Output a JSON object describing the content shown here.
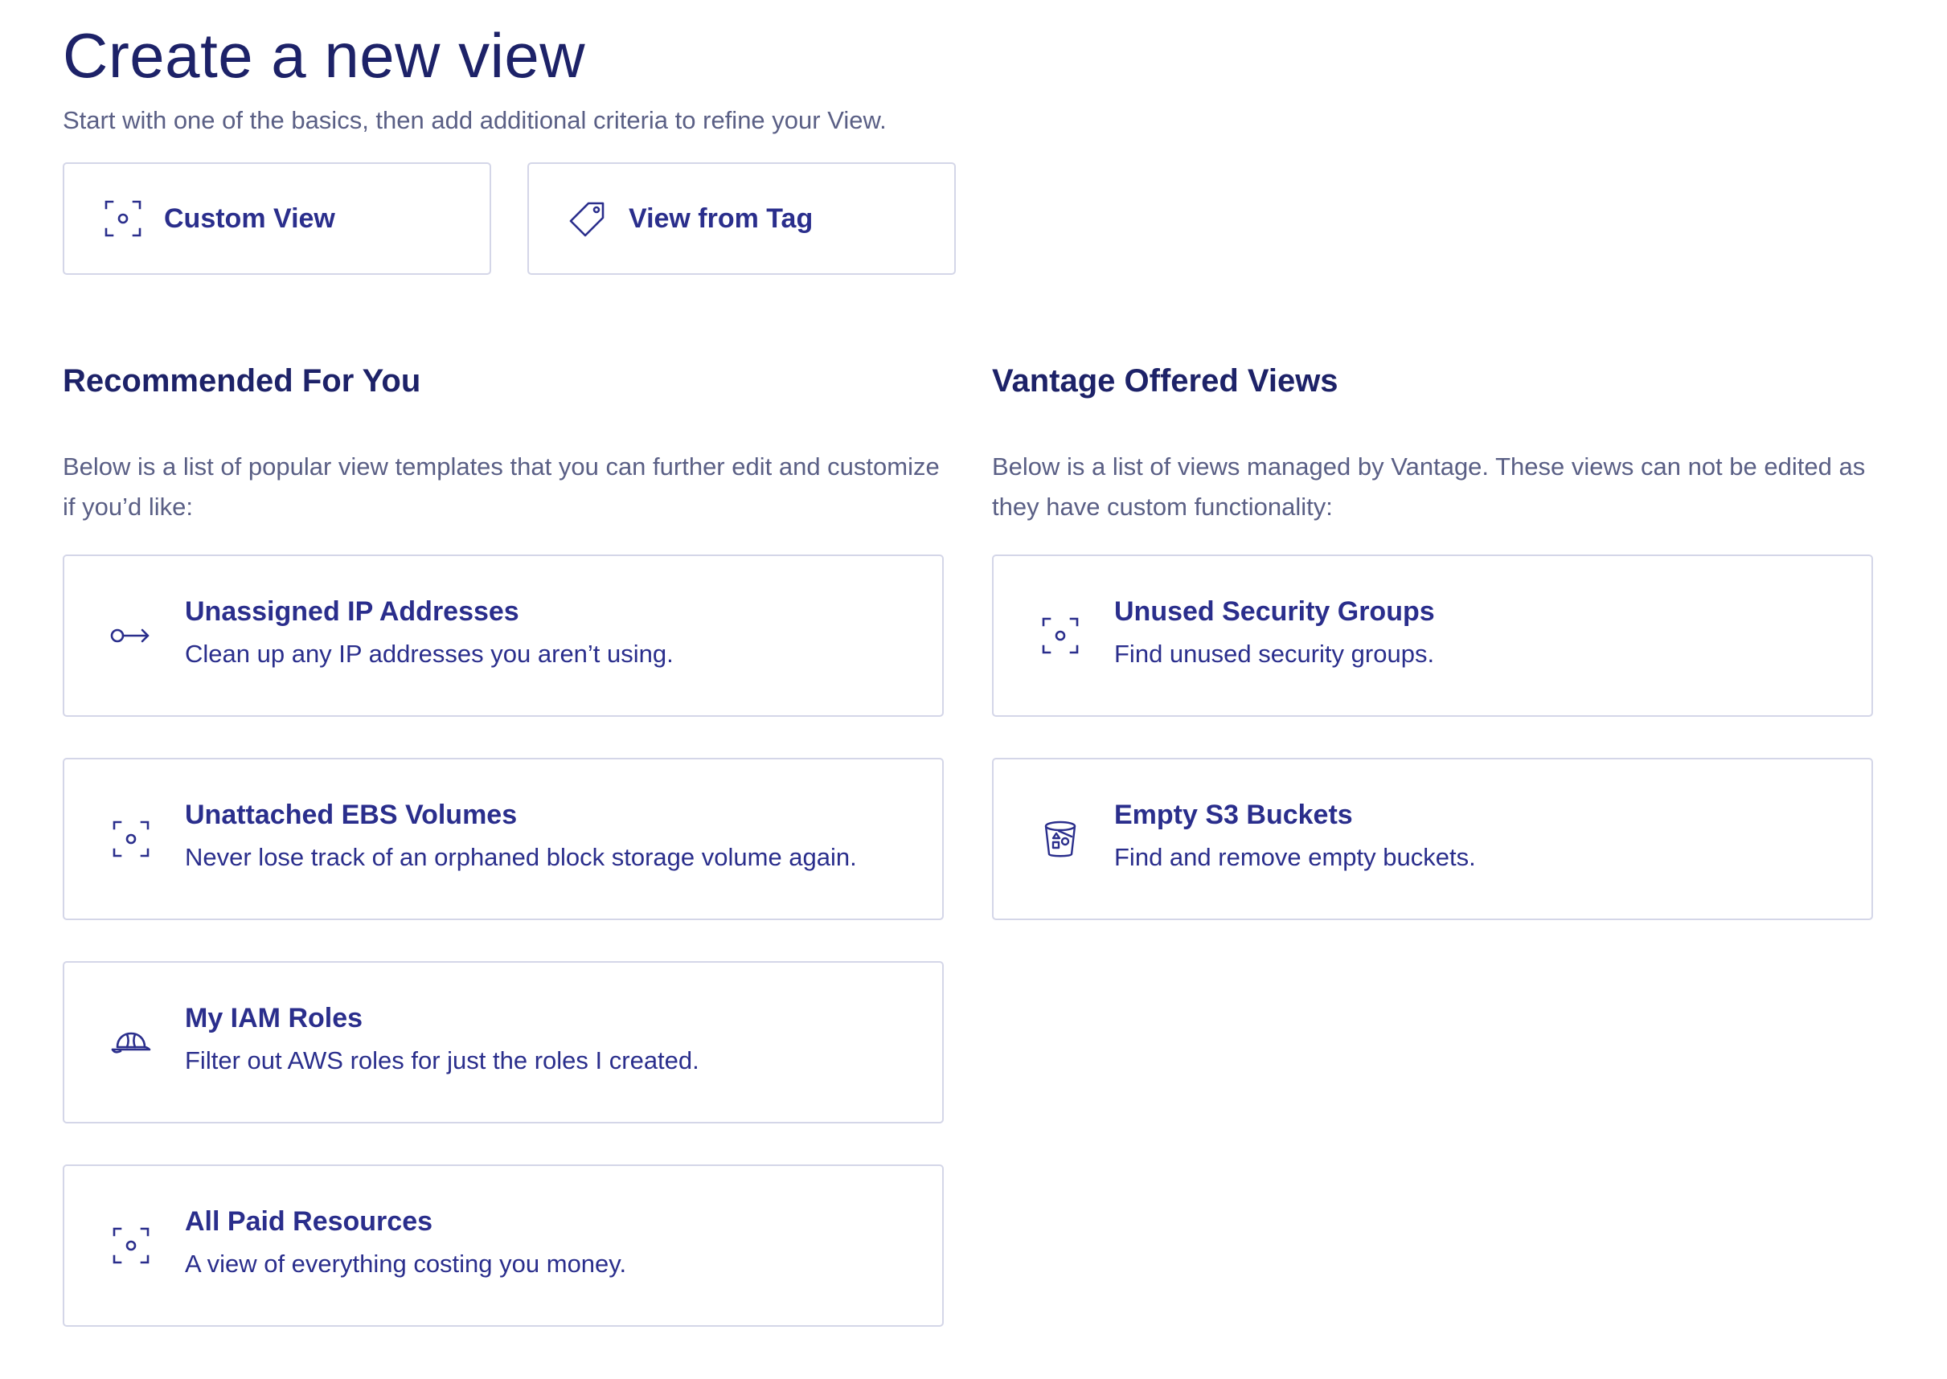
{
  "header": {
    "title": "Create a new view",
    "subtitle": "Start with one of the basics, then add additional criteria to refine your View."
  },
  "basics": [
    {
      "label": "Custom View",
      "icon": "focus-icon"
    },
    {
      "label": "View from Tag",
      "icon": "tag-icon"
    }
  ],
  "recommended": {
    "title": "Recommended For You",
    "description": "Below is a list of popular view templates that you can further edit and customize if you’d like:",
    "items": [
      {
        "name": "Unassigned IP Addresses",
        "desc": "Clean up any IP addresses you aren’t using.",
        "icon": "key-arrow-icon"
      },
      {
        "name": "Unattached EBS Volumes",
        "desc": "Never lose track of an orphaned block storage volume again.",
        "icon": "focus-icon"
      },
      {
        "name": "My IAM Roles",
        "desc": "Filter out AWS roles for just the roles I created.",
        "icon": "hard-hat-icon"
      },
      {
        "name": "All Paid Resources",
        "desc": "A view of everything costing you money.",
        "icon": "focus-icon"
      }
    ]
  },
  "vantage": {
    "title": "Vantage Offered Views",
    "description": "Below is a list of views managed by Vantage. These views can not be edited as they have custom functionality:",
    "items": [
      {
        "name": "Unused Security Groups",
        "desc": "Find unused security groups.",
        "icon": "focus-icon"
      },
      {
        "name": "Empty S3 Buckets",
        "desc": "Find and remove empty buckets.",
        "icon": "bucket-icon"
      }
    ]
  },
  "colors": {
    "primary": "#2a2e8c",
    "heading": "#1d2268",
    "muted": "#5a5f85",
    "border": "#d4d6e8"
  }
}
